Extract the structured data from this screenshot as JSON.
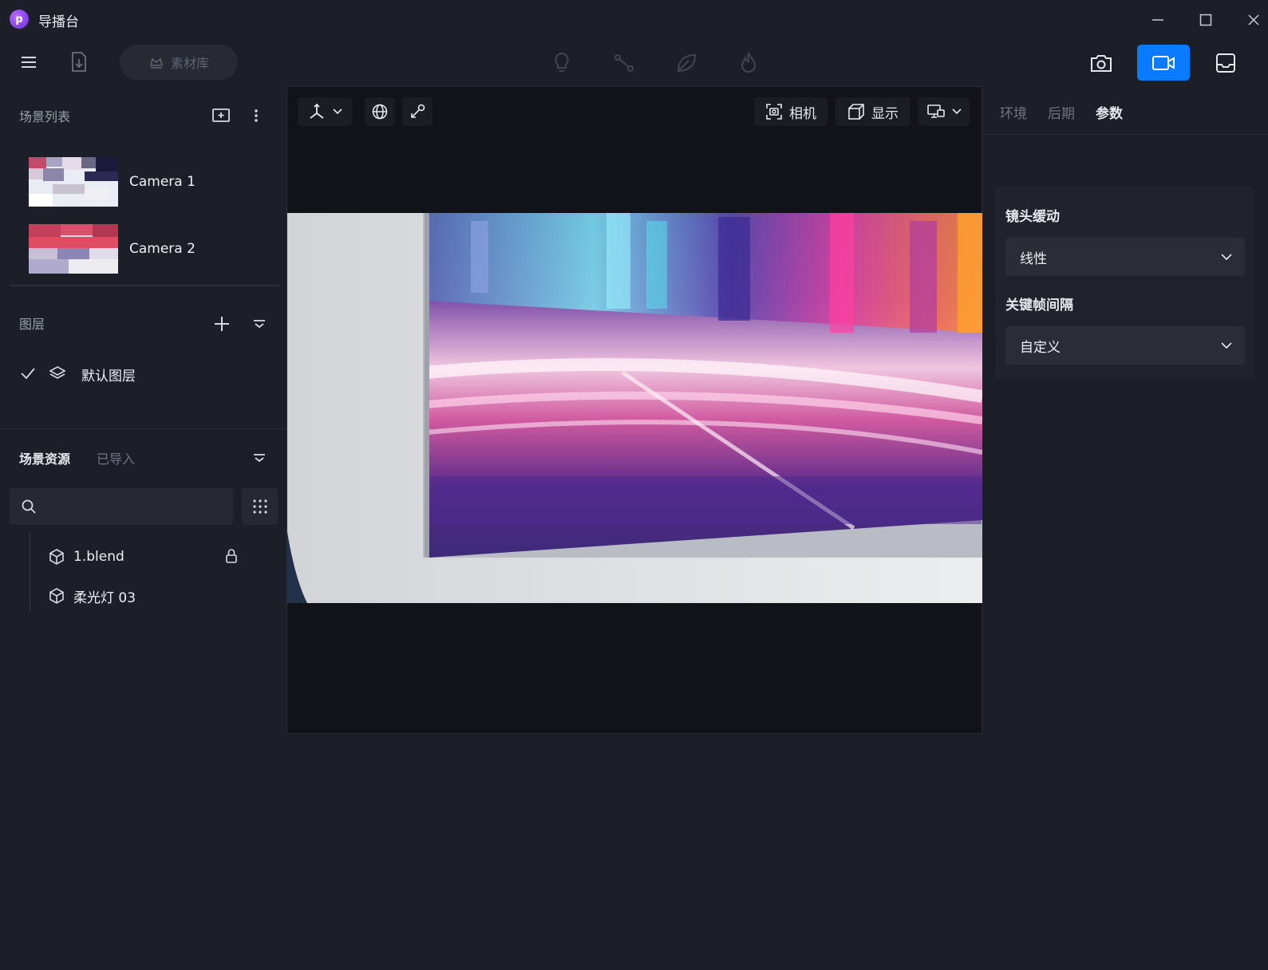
{
  "window": {
    "title": "导播台",
    "logo_letter": "p"
  },
  "toolbar": {
    "material_label": "素材库"
  },
  "scene_list": {
    "header": "场景列表",
    "cameras": [
      {
        "label": "Camera 1"
      },
      {
        "label": "Camera 2"
      }
    ]
  },
  "layers": {
    "header": "图层",
    "items": [
      {
        "label": "默认图层",
        "checked": true
      }
    ]
  },
  "scene_resources": {
    "tabs": [
      {
        "label": "场景资源",
        "active": true
      },
      {
        "label": "已导入",
        "active": false
      }
    ],
    "search_placeholder": "",
    "tree": [
      {
        "label": "1.blend",
        "locked": true
      },
      {
        "label": "柔光灯 03",
        "locked": false
      }
    ]
  },
  "viewport": {
    "camera_label": "相机",
    "display_label": "显示"
  },
  "right_panel": {
    "tabs": [
      {
        "label": "环境",
        "active": false
      },
      {
        "label": "后期",
        "active": false
      },
      {
        "label": "参数",
        "active": true
      }
    ],
    "params": {
      "ease_label": "镜头缓动",
      "ease_value": "线性",
      "keyframe_label": "关键帧间隔",
      "keyframe_value": "自定义"
    }
  },
  "colors": {
    "accent": "#0a7bff",
    "background": "#1c1f27",
    "viewport_bg": "#111318",
    "panel_card": "#20232b"
  }
}
